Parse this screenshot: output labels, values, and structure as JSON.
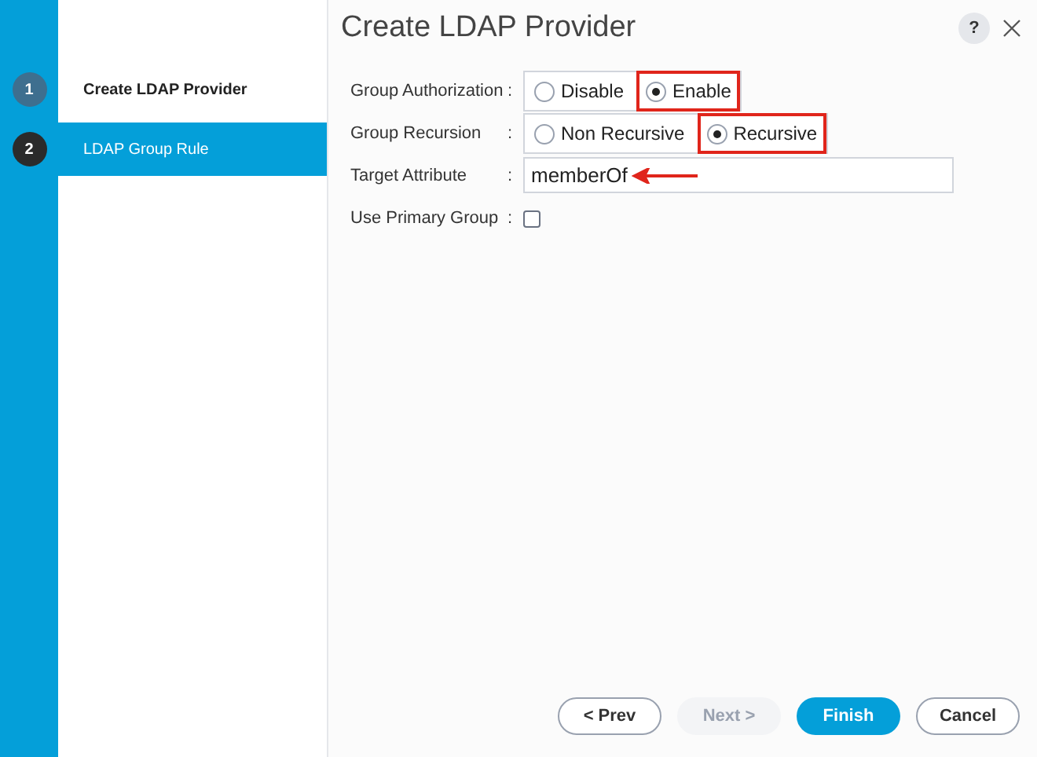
{
  "steps": [
    {
      "number": "1",
      "label": "Create LDAP Provider",
      "selected": false
    },
    {
      "number": "2",
      "label": "LDAP Group Rule",
      "selected": true
    }
  ],
  "dialog": {
    "title": "Create LDAP Provider",
    "help": "?"
  },
  "fields": [
    {
      "kind": "radio",
      "label": "Group Authorization",
      "colon": ":",
      "options": [
        {
          "label": "Disable",
          "selected": false,
          "highlighted": false
        },
        {
          "label": "Enable",
          "selected": true,
          "highlighted": true
        }
      ]
    },
    {
      "kind": "radio",
      "label": "Group Recursion",
      "colon": ":",
      "options": [
        {
          "label": "Non Recursive",
          "selected": false,
          "highlighted": false
        },
        {
          "label": "Recursive",
          "selected": true,
          "highlighted": true
        }
      ]
    },
    {
      "kind": "text",
      "label": "Target Attribute",
      "colon": ":",
      "value": "memberOf",
      "arrow": true
    },
    {
      "kind": "checkbox",
      "label": "Use Primary Group",
      "colon": ":",
      "checked": false
    }
  ],
  "buttons": [
    {
      "label": "< Prev",
      "kind": "outline",
      "disabled": false
    },
    {
      "label": "Next >",
      "kind": "outline",
      "disabled": true
    },
    {
      "label": "Finish",
      "kind": "primary",
      "disabled": false
    },
    {
      "label": "Cancel",
      "kind": "outline",
      "disabled": false
    }
  ]
}
